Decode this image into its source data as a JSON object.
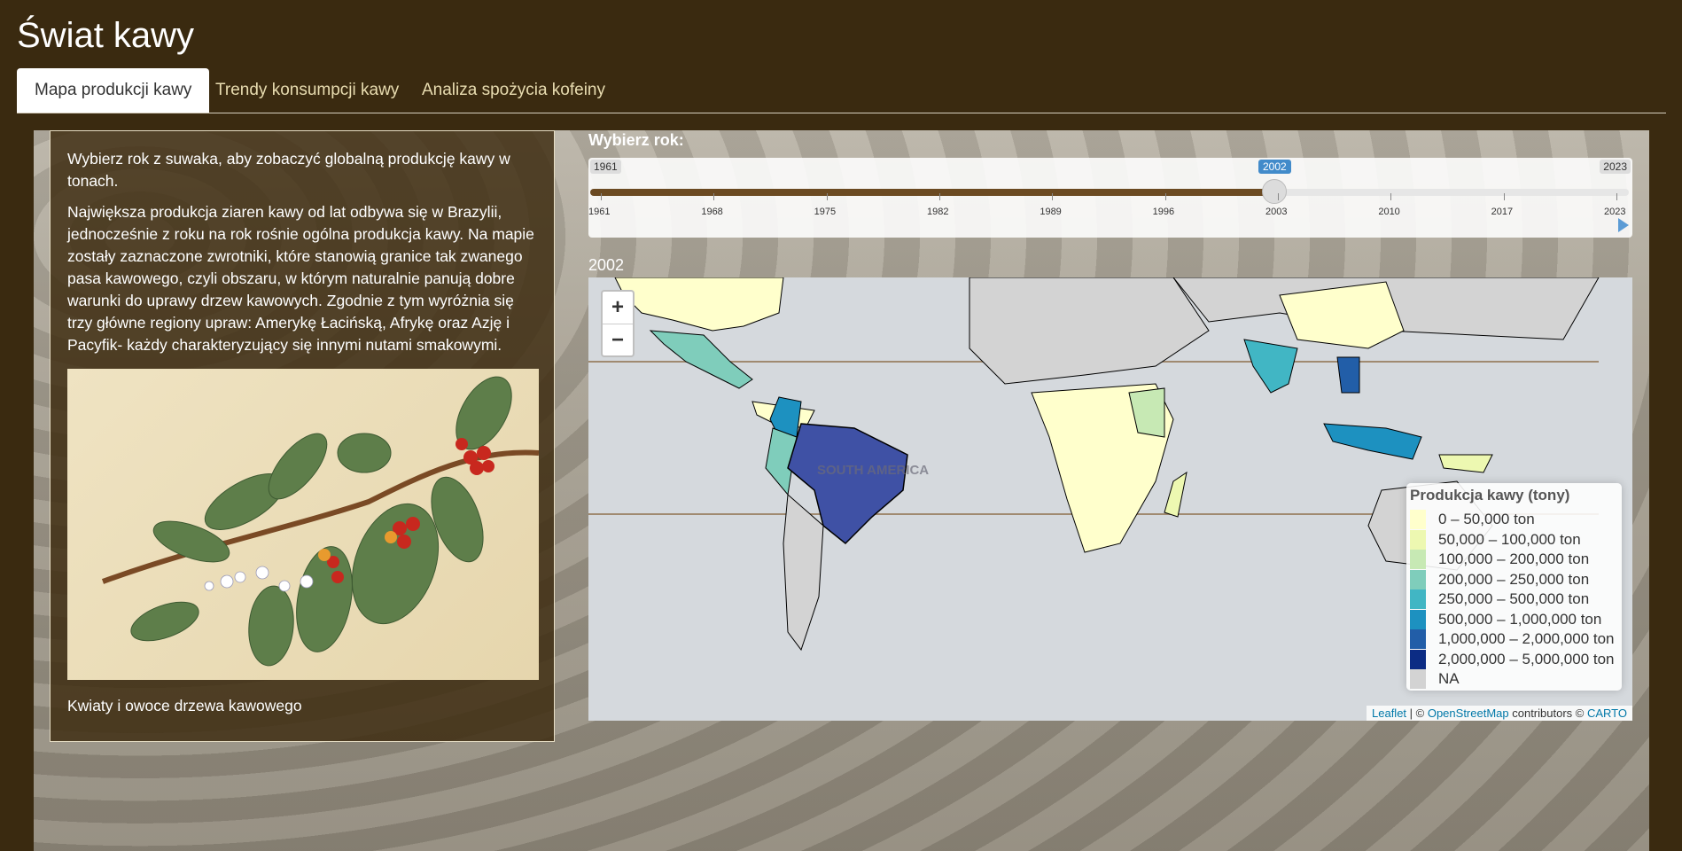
{
  "app": {
    "title": "Świat kawy"
  },
  "tabs": [
    {
      "label": "Mapa produkcji kawy",
      "active": true
    },
    {
      "label": "Trendy konsumpcji kawy",
      "active": false
    },
    {
      "label": "Analiza spożycia kofeiny",
      "active": false
    }
  ],
  "sidebar": {
    "intro": "Wybierz rok z suwaka, aby zobaczyć globalną produkcję kawy w tonach.",
    "description": "Największa produkcja ziaren kawy od lat odbywa się w Brazylii, jednocześnie z roku na rok rośnie ogólna produkcja kawy. Na mapie zostały zaznaczone zwrotniki, które stanowią granice tak zwanego pasa kawowego, czyli obszaru, w którym naturalnie panują dobre warunki do uprawy drzew kawowych. Zgodnie z tym wyróżnia się trzy główne regiony upraw: Amerykę Łacińską, Afrykę oraz Azję i Pacyfik- każdy charakteryzujący się innymi nutami smakowymi.",
    "image_caption": "Kwiaty i owoce drzewa kawowego"
  },
  "slider": {
    "label": "Wybierz rok:",
    "min": "1961",
    "max": "2023",
    "value": "2002",
    "ticks": [
      "1961",
      "1968",
      "1975",
      "1982",
      "1989",
      "1996",
      "2003",
      "2010",
      "2017",
      "2023"
    ]
  },
  "map": {
    "year_title": "2002",
    "zoom_in": "+",
    "zoom_out": "−",
    "labels": {
      "south_america": "SOUTH AMERICA"
    },
    "legend": {
      "title": "Produkcja kawy (tony)",
      "items": [
        {
          "label": "0 – 50,000 ton",
          "color": "#ffffcc"
        },
        {
          "label": "50,000 – 100,000 ton",
          "color": "#edf8b1"
        },
        {
          "label": "100,000 – 200,000 ton",
          "color": "#c7e9b4"
        },
        {
          "label": "200,000 – 250,000 ton",
          "color": "#7fcdbb"
        },
        {
          "label": "250,000 – 500,000 ton",
          "color": "#41b6c4"
        },
        {
          "label": "500,000 – 1,000,000 ton",
          "color": "#1d91c0"
        },
        {
          "label": "1,000,000 – 2,000,000 ton",
          "color": "#225ea8"
        },
        {
          "label": "2,000,000 – 5,000,000 ton",
          "color": "#0c2c84"
        },
        {
          "label": "NA",
          "color": "#d3d3d3"
        }
      ]
    },
    "attribution": {
      "leaflet": "Leaflet",
      "separator": " | © ",
      "osm": "OpenStreetMap",
      "contributors": " contributors © ",
      "carto": "CARTO"
    }
  }
}
